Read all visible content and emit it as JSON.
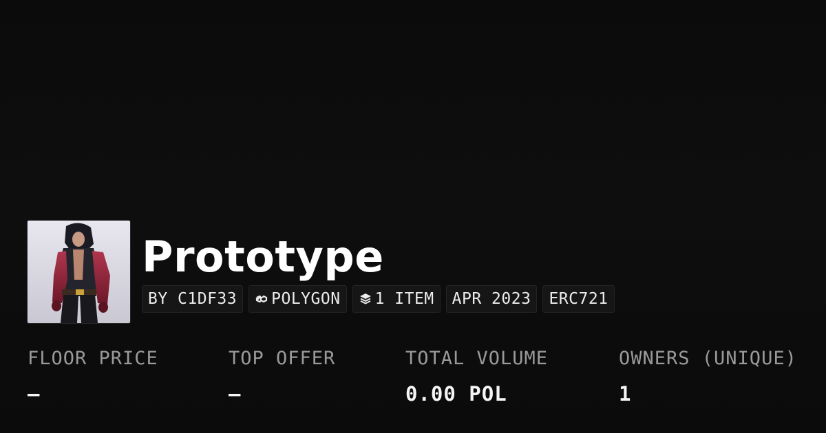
{
  "collection": {
    "name": "Prototype",
    "avatar_icon": "collection-avatar-image"
  },
  "badges": {
    "creator": "BY C1DF33",
    "chain": "POLYGON",
    "chain_icon": "chain-link-icon",
    "items": "1 ITEM",
    "items_icon": "layers-icon",
    "date": "APR 2023",
    "standard": "ERC721"
  },
  "stats": [
    {
      "label": "FLOOR PRICE",
      "value": "–"
    },
    {
      "label": "TOP OFFER",
      "value": "–"
    },
    {
      "label": "TOTAL VOLUME",
      "value": "0.00 POL"
    },
    {
      "label": "OWNERS (UNIQUE)",
      "value": "1"
    }
  ],
  "colors": {
    "background": "#0b0b0b",
    "badge_bg": "#161616",
    "label": "#9a9a9a",
    "text": "#ffffff"
  }
}
